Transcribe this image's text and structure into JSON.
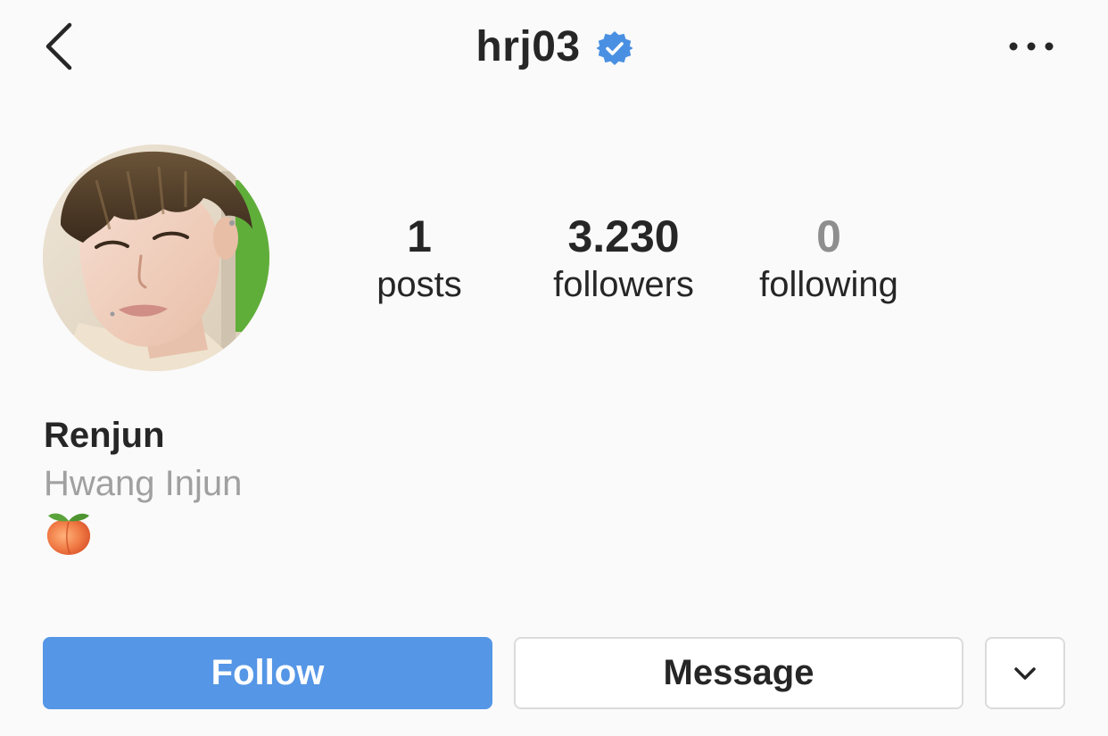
{
  "header": {
    "username": "hrj03",
    "verified": true,
    "back_icon": "chevron-left-icon",
    "more_icon": "more-horizontal-icon"
  },
  "profile": {
    "avatar_icon": "profile-photo",
    "stats": {
      "posts": {
        "value": "1",
        "label": "posts"
      },
      "followers": {
        "value": "3.230",
        "label": "followers"
      },
      "following": {
        "value": "0",
        "label": "following"
      }
    },
    "display_name": "Renjun",
    "full_name": "Hwang Injun",
    "bio_emoji": "peach-emoji"
  },
  "actions": {
    "follow_label": "Follow",
    "message_label": "Message",
    "suggest_icon": "chevron-down-icon"
  },
  "colors": {
    "background": "#fafafa",
    "primary_text": "#262626",
    "secondary_text": "#a0a0a0",
    "follow_button": "#5596e6",
    "verified_badge": "#4a90e2",
    "button_border": "#dbdbdb"
  }
}
